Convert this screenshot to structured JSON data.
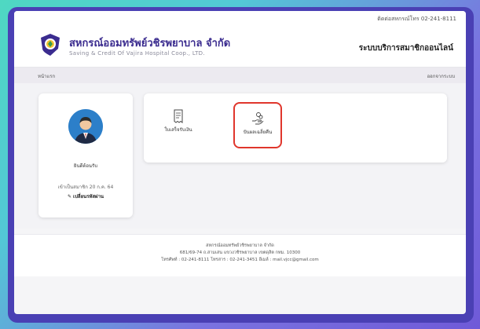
{
  "topbar": {
    "contact": "ติดต่อสหกรณ์โทร 02-241-8111"
  },
  "header": {
    "brand_th": "สหกรณ์ออมทรัพย์วชิรพยาบาล จำกัด",
    "brand_en": "Saving & Credit Of Vajira Hospital Coop., LTD.",
    "system_title": "ระบบบริการสมาชิกออนไลน์"
  },
  "nav": {
    "home": "หน้าแรก",
    "logout": "ออกจากระบบ"
  },
  "profile": {
    "name": "ยินดีต้อนรับ",
    "member_since": "เข้าเป็นสมาชิก 20 ก.ค. 64",
    "edit_label": "✎ เปลี่ยนรหัสผ่าน"
  },
  "menu": [
    {
      "label": "ใบเสร็จรับเงิน",
      "icon": "receipt-icon"
    },
    {
      "label": "ปันผลเฉลี่ยคืน",
      "icon": "hand-coins-icon"
    }
  ],
  "footer": {
    "line1": "สหกรณ์ออมทรัพย์วชิรพยาบาล จำกัด",
    "line2": "681/69-74 ถ.สามเสน แขวงวชิรพยาบาล เขตดุสิต กทม. 10300",
    "line3": "โทรศัพท์ : 02-241-8111 โทรสาร : 02-241-3451 อีเมล์ : mail.vjcc@gmail.com"
  },
  "colors": {
    "frame": "#4a40b4",
    "highlight": "#e0362c",
    "brand": "#3b2c8f"
  }
}
